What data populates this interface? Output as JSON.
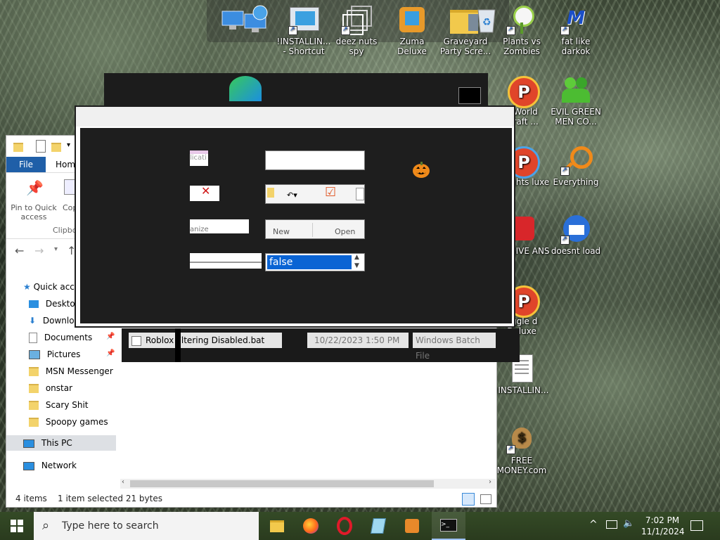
{
  "desktop": {
    "icons": [
      {
        "label": "!INSTALLIN... - Shortcut"
      },
      {
        "label": "deez nuts spy"
      },
      {
        "label": "Zuma Deluxe"
      },
      {
        "label": "Graveyard Party Scre..."
      },
      {
        "label": "Plants vs Zombies"
      },
      {
        "label": "fat like darkok"
      },
      {
        "label": "e World rcraft ..."
      },
      {
        "label": "EVIL GREEN MEN CO..."
      },
      {
        "label": "e Nights luxe"
      },
      {
        "label": "Everything"
      },
      {
        "label": "RESSIVE ANS"
      },
      {
        "label": "doesnt load"
      },
      {
        "label": "eggle d Deluxe"
      },
      {
        "label": "!INSTALLIN..."
      },
      {
        "label": "FREE MONEY.com"
      }
    ]
  },
  "explorer": {
    "ribbon_file_tab": "File",
    "ribbon_home_tab": "Home",
    "pin_label": "Pin to Quick access",
    "copy_label": "Cop",
    "clipboard_group": "Clipbo",
    "nav": {
      "quick_access": "Quick acc",
      "desktop": "Desktop",
      "downloads": "Downlo",
      "documents": "Documents",
      "pictures": "Pictures",
      "msn": "MSN Messenger",
      "onstar": "onstar",
      "scary": "Scary Shit",
      "spoopy": "Spoopy games",
      "this_pc": "This PC",
      "network": "Network"
    },
    "file_row": {
      "name_pre": "Roblox F",
      "name_post": "ltering Disabled.bat",
      "date": "10/22/2023 1:50 PM",
      "type": "Windows Batch File"
    },
    "status": {
      "items": "4 items",
      "selected": "1 item selected  21 bytes"
    }
  },
  "dialog": {
    "frag_1": "licati",
    "frag_organize": "anize",
    "btn_new": "New",
    "btn_open": "Open",
    "combo_value": "false"
  },
  "taskbar": {
    "search_placeholder": "Type here to search",
    "time": "7:02 PM",
    "date": "11/1/2024"
  }
}
